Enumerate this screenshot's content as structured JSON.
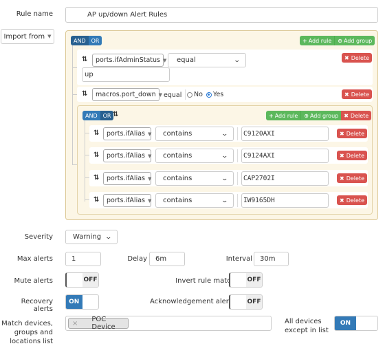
{
  "rule_name": {
    "label": "Rule name",
    "value": "AP up/down Alert Rules"
  },
  "import_from": {
    "label": "Import from"
  },
  "builder": {
    "root_group": {
      "conditions": [
        "AND",
        "OR"
      ],
      "active_condition": "AND",
      "add_rule_label": "Add rule",
      "add_group_label": "Add group",
      "rules": [
        {
          "field": "ports.ifAdminStatus",
          "operator": "equal",
          "value": "up",
          "delete_label": "Delete"
        },
        {
          "field": "macros.port_down",
          "operator": "equal",
          "radio_options": [
            "No",
            "Yes"
          ],
          "selected": "Yes",
          "delete_label": "Delete"
        }
      ]
    },
    "sub_group": {
      "conditions": [
        "AND",
        "OR"
      ],
      "active_condition": "AND",
      "add_rule_label": "Add rule",
      "add_group_label": "Add group",
      "delete_label": "Delete",
      "rules": [
        {
          "field": "ports.ifAlias",
          "operator": "contains",
          "value": "C9120AXI",
          "delete_label": "Delete"
        },
        {
          "field": "ports.ifAlias",
          "operator": "contains",
          "value": "C9124AXI",
          "delete_label": "Delete"
        },
        {
          "field": "ports.ifAlias",
          "operator": "contains",
          "value": "CAP2702I",
          "delete_label": "Delete"
        },
        {
          "field": "ports.ifAlias",
          "operator": "contains",
          "value": "IW9165DH",
          "delete_label": "Delete"
        }
      ]
    }
  },
  "severity": {
    "label": "Severity",
    "value": "Warning"
  },
  "max_alerts": {
    "label": "Max alerts",
    "value": "1"
  },
  "delay": {
    "label": "Delay",
    "value": "6m"
  },
  "interval": {
    "label": "Interval",
    "value": "30m"
  },
  "mute_alerts": {
    "label": "Mute alerts",
    "state": "OFF"
  },
  "invert_rule_match": {
    "label": "Invert rule match",
    "state": "OFF"
  },
  "recovery_alerts": {
    "label": "Recovery alerts",
    "state": "ON"
  },
  "acknowledgement_alerts": {
    "label": "Acknowledgement alerts",
    "state": "OFF"
  },
  "match_devices": {
    "label_line1": "Match devices,",
    "label_line2": "groups and",
    "label_line3": "locations list",
    "tags": [
      "POC Device"
    ],
    "remove_glyph": "×"
  },
  "all_devices_except": {
    "label_line1": "All devices",
    "label_line2": "except in list",
    "state": "ON"
  },
  "colors": {
    "primary": "#337ab7",
    "success": "#5cb85c",
    "danger": "#d9534f",
    "group_bg": "#fcf6e6"
  }
}
